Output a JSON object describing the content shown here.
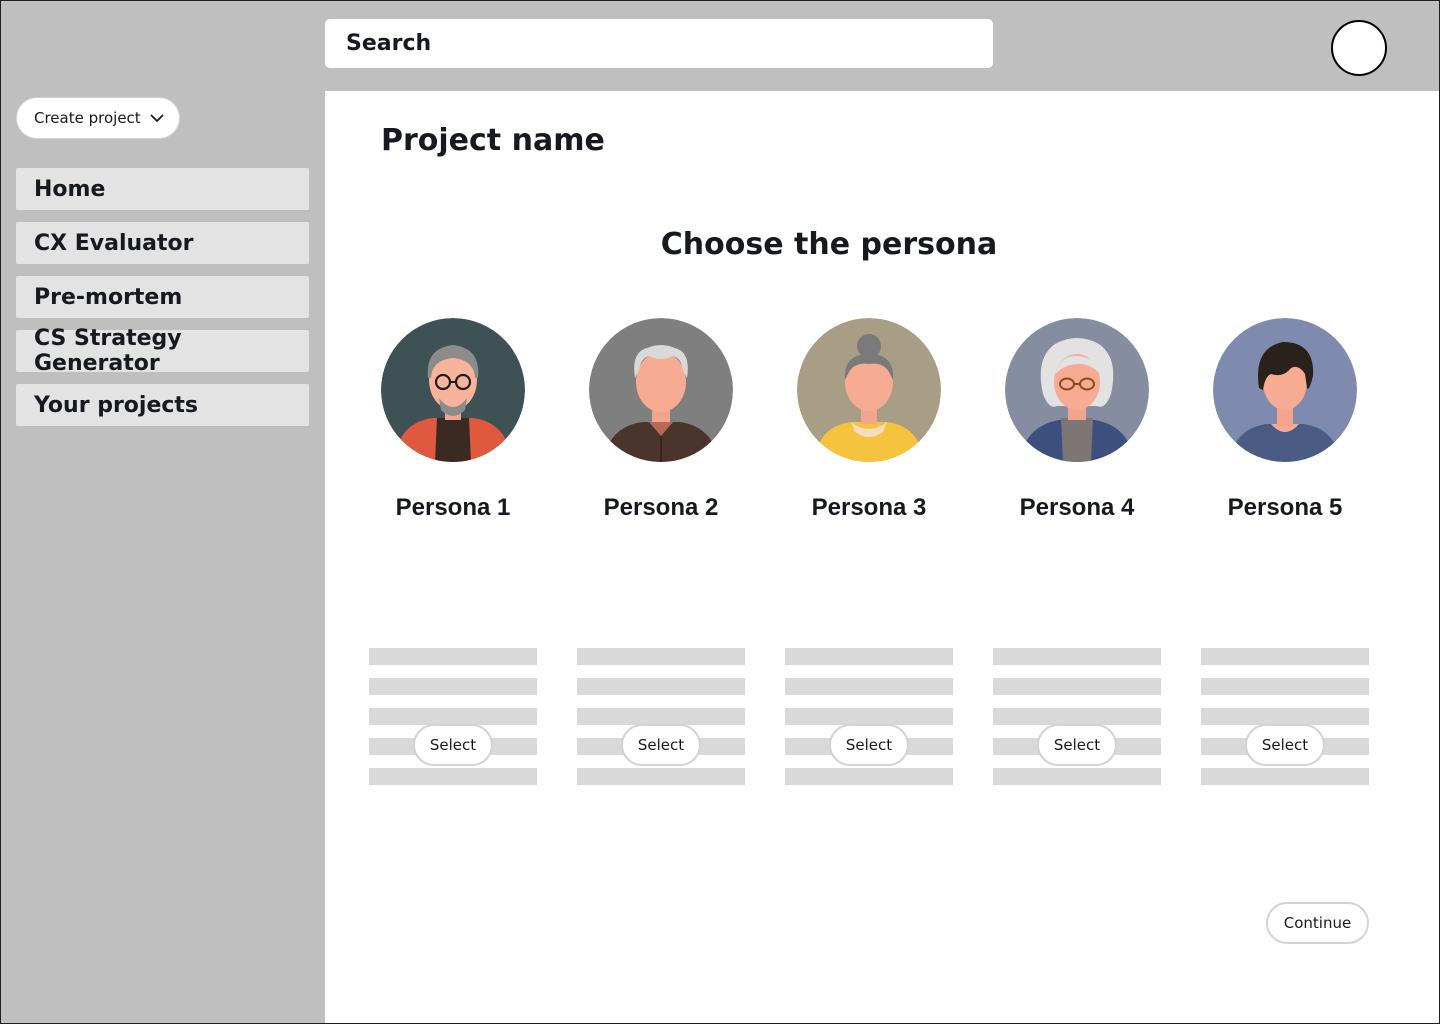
{
  "header": {
    "search_label": "Search"
  },
  "sidebar": {
    "create_button_label": "Create project",
    "items": [
      {
        "label": "Home"
      },
      {
        "label": "CX Evaluator"
      },
      {
        "label": "Pre-mortem"
      },
      {
        "label": "CS Strategy Generator"
      },
      {
        "label": "Your projects"
      }
    ]
  },
  "main": {
    "project_title": "Project name",
    "heading": "Choose the persona",
    "personas": [
      {
        "name": "Persona 1",
        "select_label": "Select",
        "avatar_bg": "#3e5154"
      },
      {
        "name": "Persona 2",
        "select_label": "Select",
        "avatar_bg": "#7f7f7f"
      },
      {
        "name": "Persona 3",
        "select_label": "Select",
        "avatar_bg": "#a89e85"
      },
      {
        "name": "Persona 4",
        "select_label": "Select",
        "avatar_bg": "#878da0"
      },
      {
        "name": "Persona 5",
        "select_label": "Select",
        "avatar_bg": "#7f8aaf"
      }
    ],
    "continue_label": "Continue"
  },
  "colors": {
    "chrome_bg": "#bfbfbf",
    "content_bg": "#ffffff",
    "nav_item_bg": "#e3e3e3",
    "placeholder_line": "#d9d9d9",
    "text": "#16191f"
  }
}
